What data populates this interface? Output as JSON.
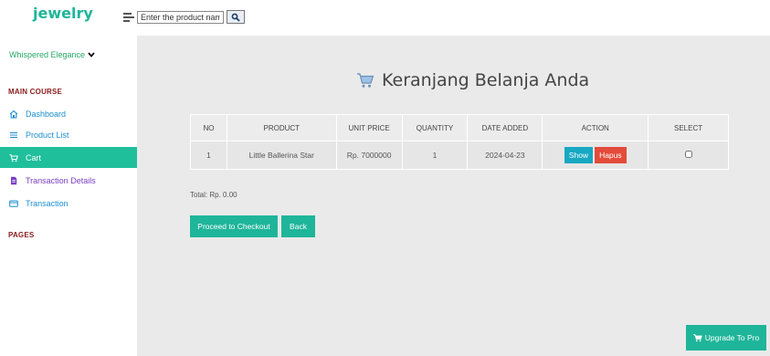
{
  "header": {
    "brand": "jewelry",
    "search": {
      "placeholder": "Enter the product name",
      "value": ""
    }
  },
  "sidebar": {
    "user_name": "Whispered Elegance",
    "sections": {
      "main_course": "MAIN COURSE",
      "pages": "PAGES"
    },
    "items": [
      {
        "label": "Dashboard",
        "icon": "home-icon"
      },
      {
        "label": "Product List",
        "icon": "list-icon"
      },
      {
        "label": "Cart",
        "icon": "cart-icon",
        "active": true
      },
      {
        "label": "Transaction Details",
        "icon": "document-icon"
      },
      {
        "label": "Transaction",
        "icon": "credit-card-icon"
      }
    ]
  },
  "main": {
    "title": "Keranjang Belanja Anda",
    "title_icon": "shopping-cart-icon",
    "table": {
      "headers": [
        "NO",
        "PRODUCT",
        "UNIT PRICE",
        "QUANTITY",
        "DATE ADDED",
        "ACTION",
        "SELECT"
      ],
      "rows": [
        {
          "no": "1",
          "product": "Little Ballerina Star",
          "unit_price": "Rp. 7000000",
          "quantity": "1",
          "date_added": "2024-04-23",
          "show_label": "Show",
          "delete_label": "Hapus",
          "selected": false
        }
      ]
    },
    "total": "Total: Rp. 0.00",
    "checkout_label": "Proceed to Checkout",
    "back_label": "Back"
  },
  "upgrade_label": "Upgrade To Pro",
  "colors": {
    "accent": "#1fb59a",
    "show": "#17a8c2",
    "delete": "#e34b3a",
    "section_title": "#8a1c1c"
  }
}
